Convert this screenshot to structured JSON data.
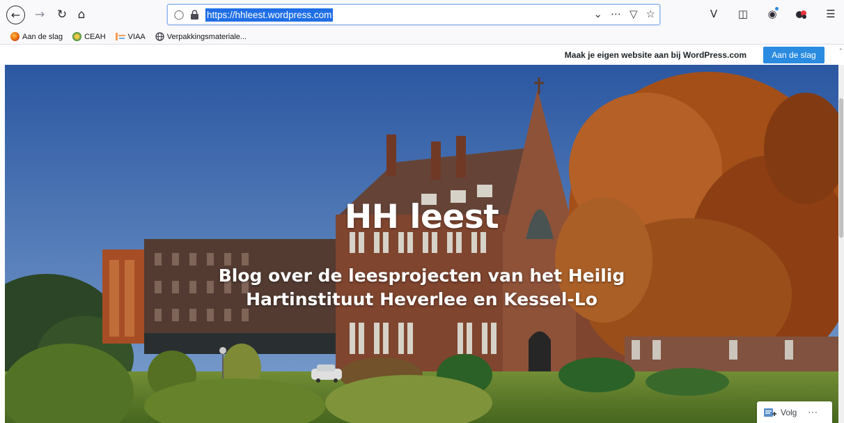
{
  "browser": {
    "url": "https://hhleest.wordpress.com",
    "nav_icons": {
      "back": "arrow-left-icon",
      "forward": "arrow-right-icon",
      "reload": "reload-icon",
      "home": "home-icon"
    },
    "bookmarks": [
      {
        "label": "Aan de slag",
        "icon": "firefox-icon",
        "color": "#e66000"
      },
      {
        "label": "CEAH",
        "icon": "globe-leaf-icon",
        "color": "#2e8b3b"
      },
      {
        "label": "VIAA",
        "icon": "viaa-logo-icon",
        "color": "#f39c5a"
      },
      {
        "label": "Verpakkingsmateriale...",
        "icon": "globe-icon",
        "color": "#3a3a44"
      }
    ]
  },
  "wpbar": {
    "text": "Maak je eigen website aan bij WordPress.com",
    "button": "Aan de slag"
  },
  "hero": {
    "title": "HH leest",
    "subtitle_line1": "Blog over de leesprojecten van het Heilig",
    "subtitle_line2": "Hartinstituut Heverlee en Kessel-Lo"
  },
  "follow": {
    "label": "Volg",
    "more": "···"
  },
  "colors": {
    "accent": "#2a8be0",
    "url_highlight": "#1f6ee6"
  }
}
